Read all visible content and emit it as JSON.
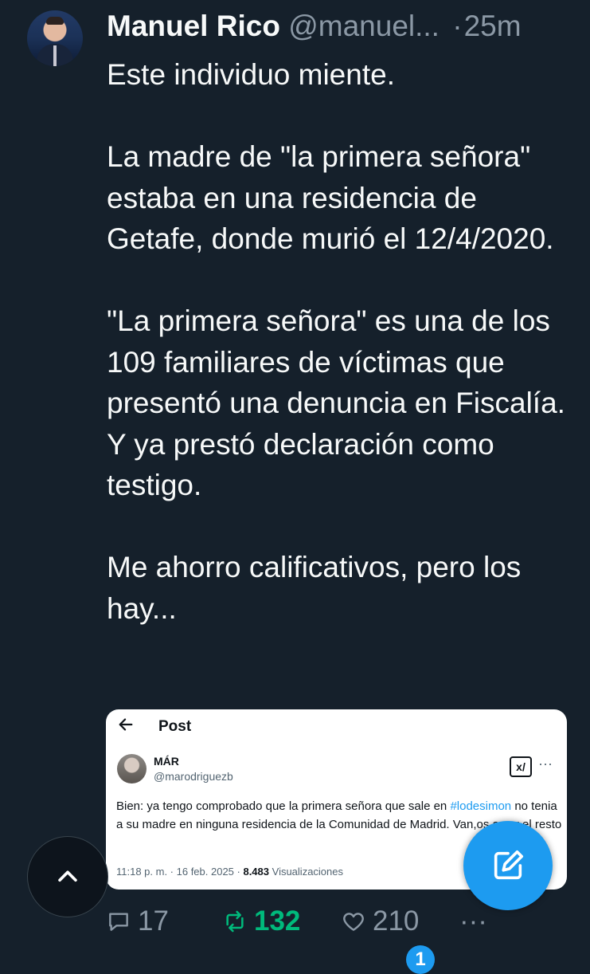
{
  "tweet": {
    "author_name": "Manuel Rico",
    "handle": "@manuel...",
    "separator": "·",
    "time": "25m",
    "paragraphs": [
      "Este individuo miente.",
      "La madre de \"la primera señora\" estaba en una residencia de Getafe, donde murió el 12/4/2020.",
      "\"La primera señora\" es una de los 109 familiares de víctimas que presentó una denuncia en Fiscalía. Y ya prestó declaración como testigo.",
      "Me ahorro calificativos, pero los hay..."
    ]
  },
  "embedded_post": {
    "back_icon": "arrow-left-icon",
    "title": "Post",
    "author_name": "MÁR",
    "handle": "@marodriguezb",
    "grok_icon": "grok-icon",
    "grok_label": "x/",
    "more_label": "···",
    "text_before_tag": "Bien: ya tengo comprobado que la primera señora que sale en ",
    "hashtag": "#lodesimon",
    "text_after_tag": " no tenia a su madre en ninguna residencia de la Comunidad de Madrid. Van,os a ver el resto",
    "timestamp": "11:18 p. m. · 16 feb. 2025 · ",
    "views_count": "8.483",
    "views_label": " Visualizaciones"
  },
  "actions": {
    "replies": "17",
    "retweets": "132",
    "likes": "210",
    "more_label": "···",
    "retweet_color": "#00ba7c"
  },
  "fab": {
    "scroll_top_icon": "chevron-up-icon",
    "compose_icon": "compose-icon",
    "accent": "#1d9bf0"
  },
  "notification_badge": "1"
}
